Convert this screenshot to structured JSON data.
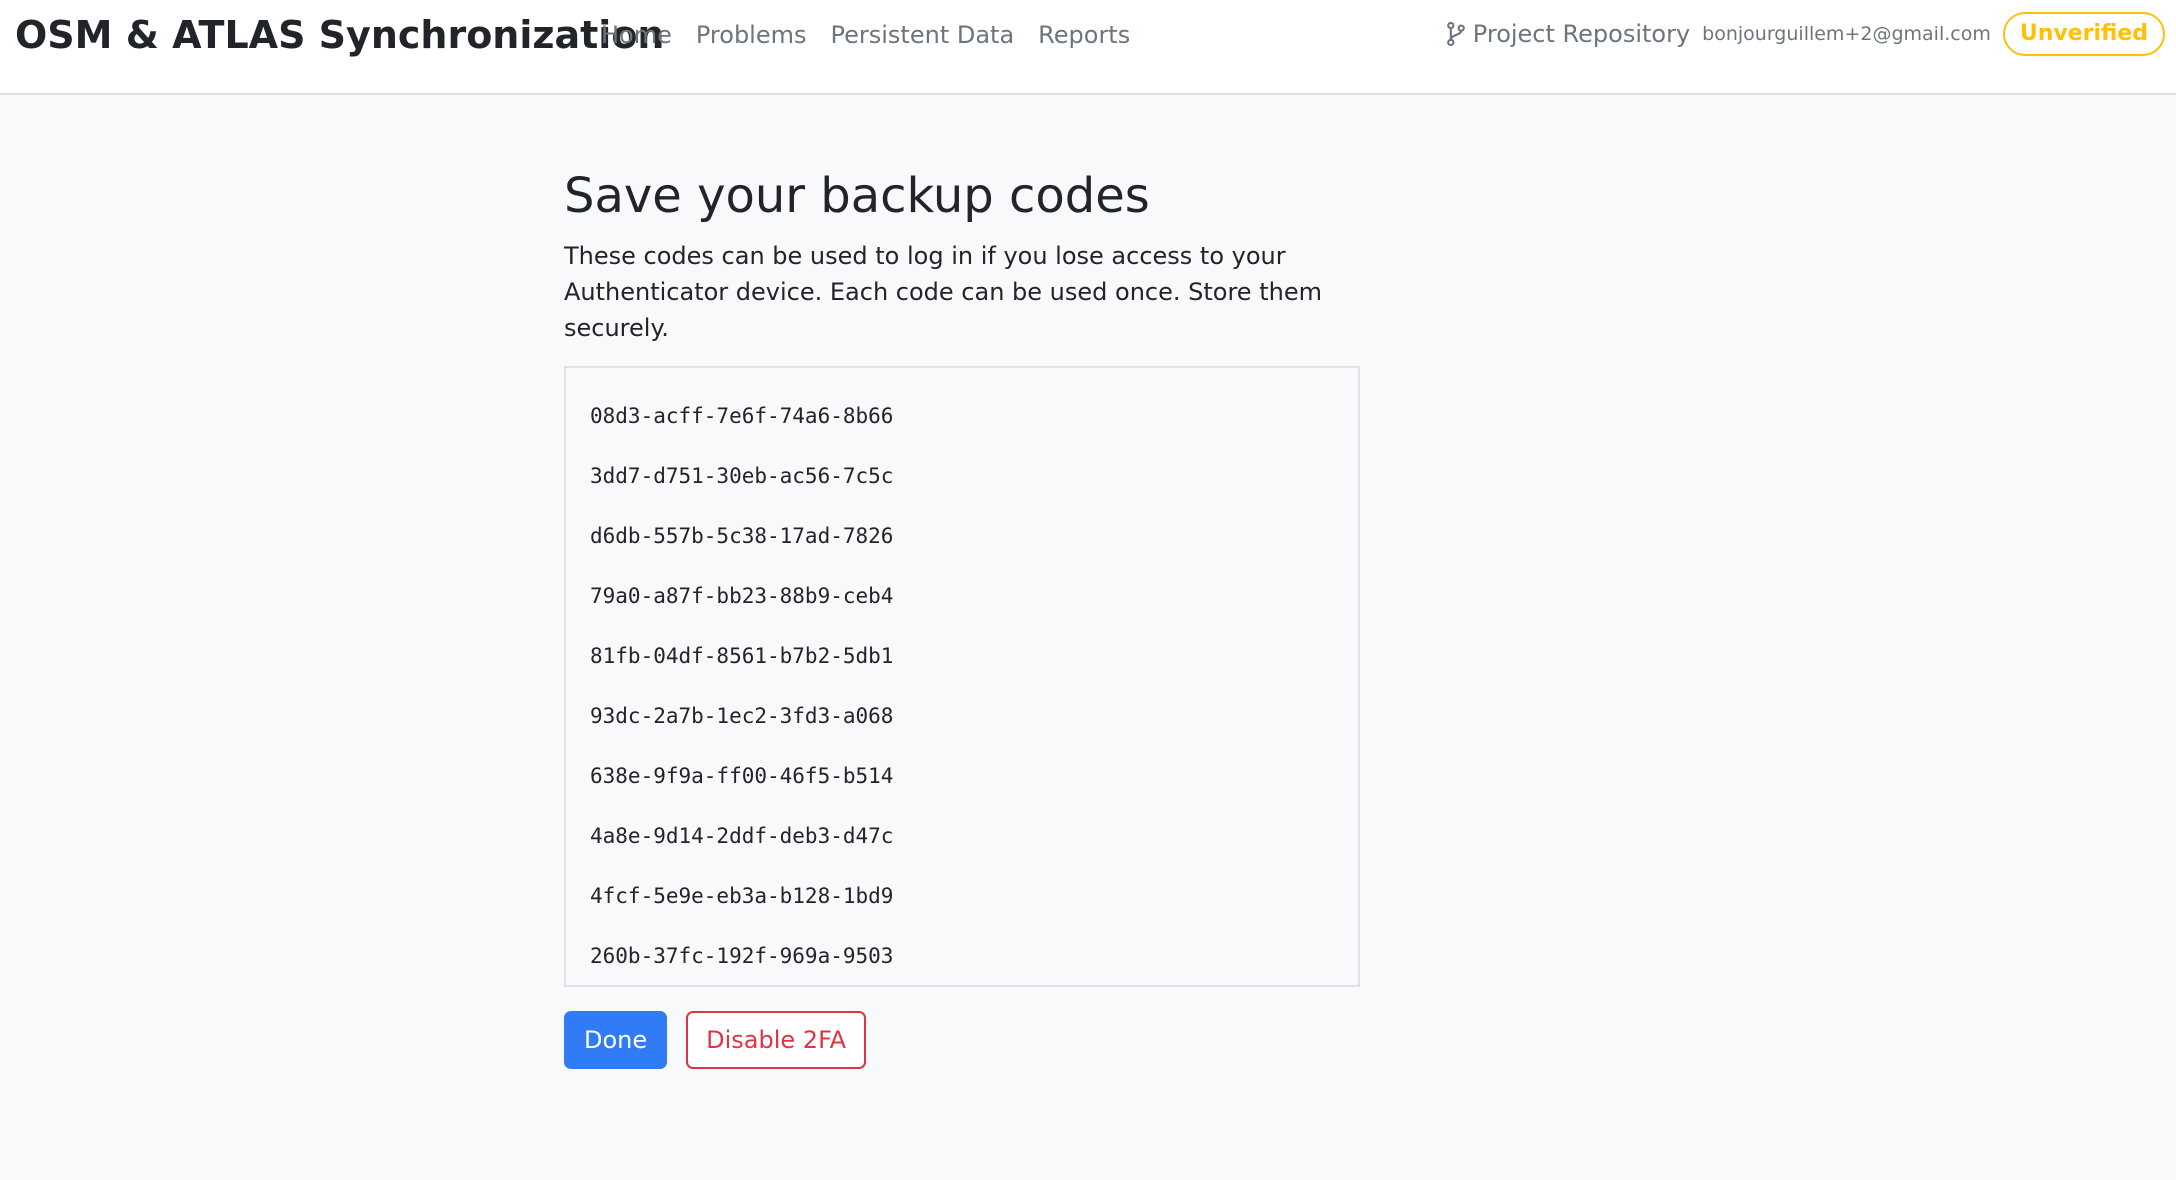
{
  "navbar": {
    "brand": "OSM & ATLAS Synchronization",
    "links": [
      "Home",
      "Problems",
      "Persistent Data",
      "Reports"
    ],
    "repo_icon": "git-branch-icon",
    "repo_label": "Project Repository",
    "user_email": "bonjourguillem+2@gmail.com",
    "status_badge": "Unverified"
  },
  "main": {
    "title": "Save your backup codes",
    "description": "These codes can be used to log in if you lose access to your Authenticator device. Each code can be used once. Store them securely.",
    "codes": [
      "08d3-acff-7e6f-74a6-8b66",
      "3dd7-d751-30eb-ac56-7c5c",
      "d6db-557b-5c38-17ad-7826",
      "79a0-a87f-bb23-88b9-ceb4",
      "81fb-04df-8561-b7b2-5db1",
      "93dc-2a7b-1ec2-3fd3-a068",
      "638e-9f9a-ff00-46f5-b514",
      "4a8e-9d14-2ddf-deb3-d47c",
      "4fcf-5e9e-eb3a-b128-1bd9",
      "260b-37fc-192f-969a-9503"
    ],
    "done_label": "Done",
    "disable_label": "Disable 2FA"
  },
  "colors": {
    "primary": "#2f7cf6",
    "danger": "#dc3545",
    "warning": "#ffc107",
    "muted": "#6c757d"
  }
}
